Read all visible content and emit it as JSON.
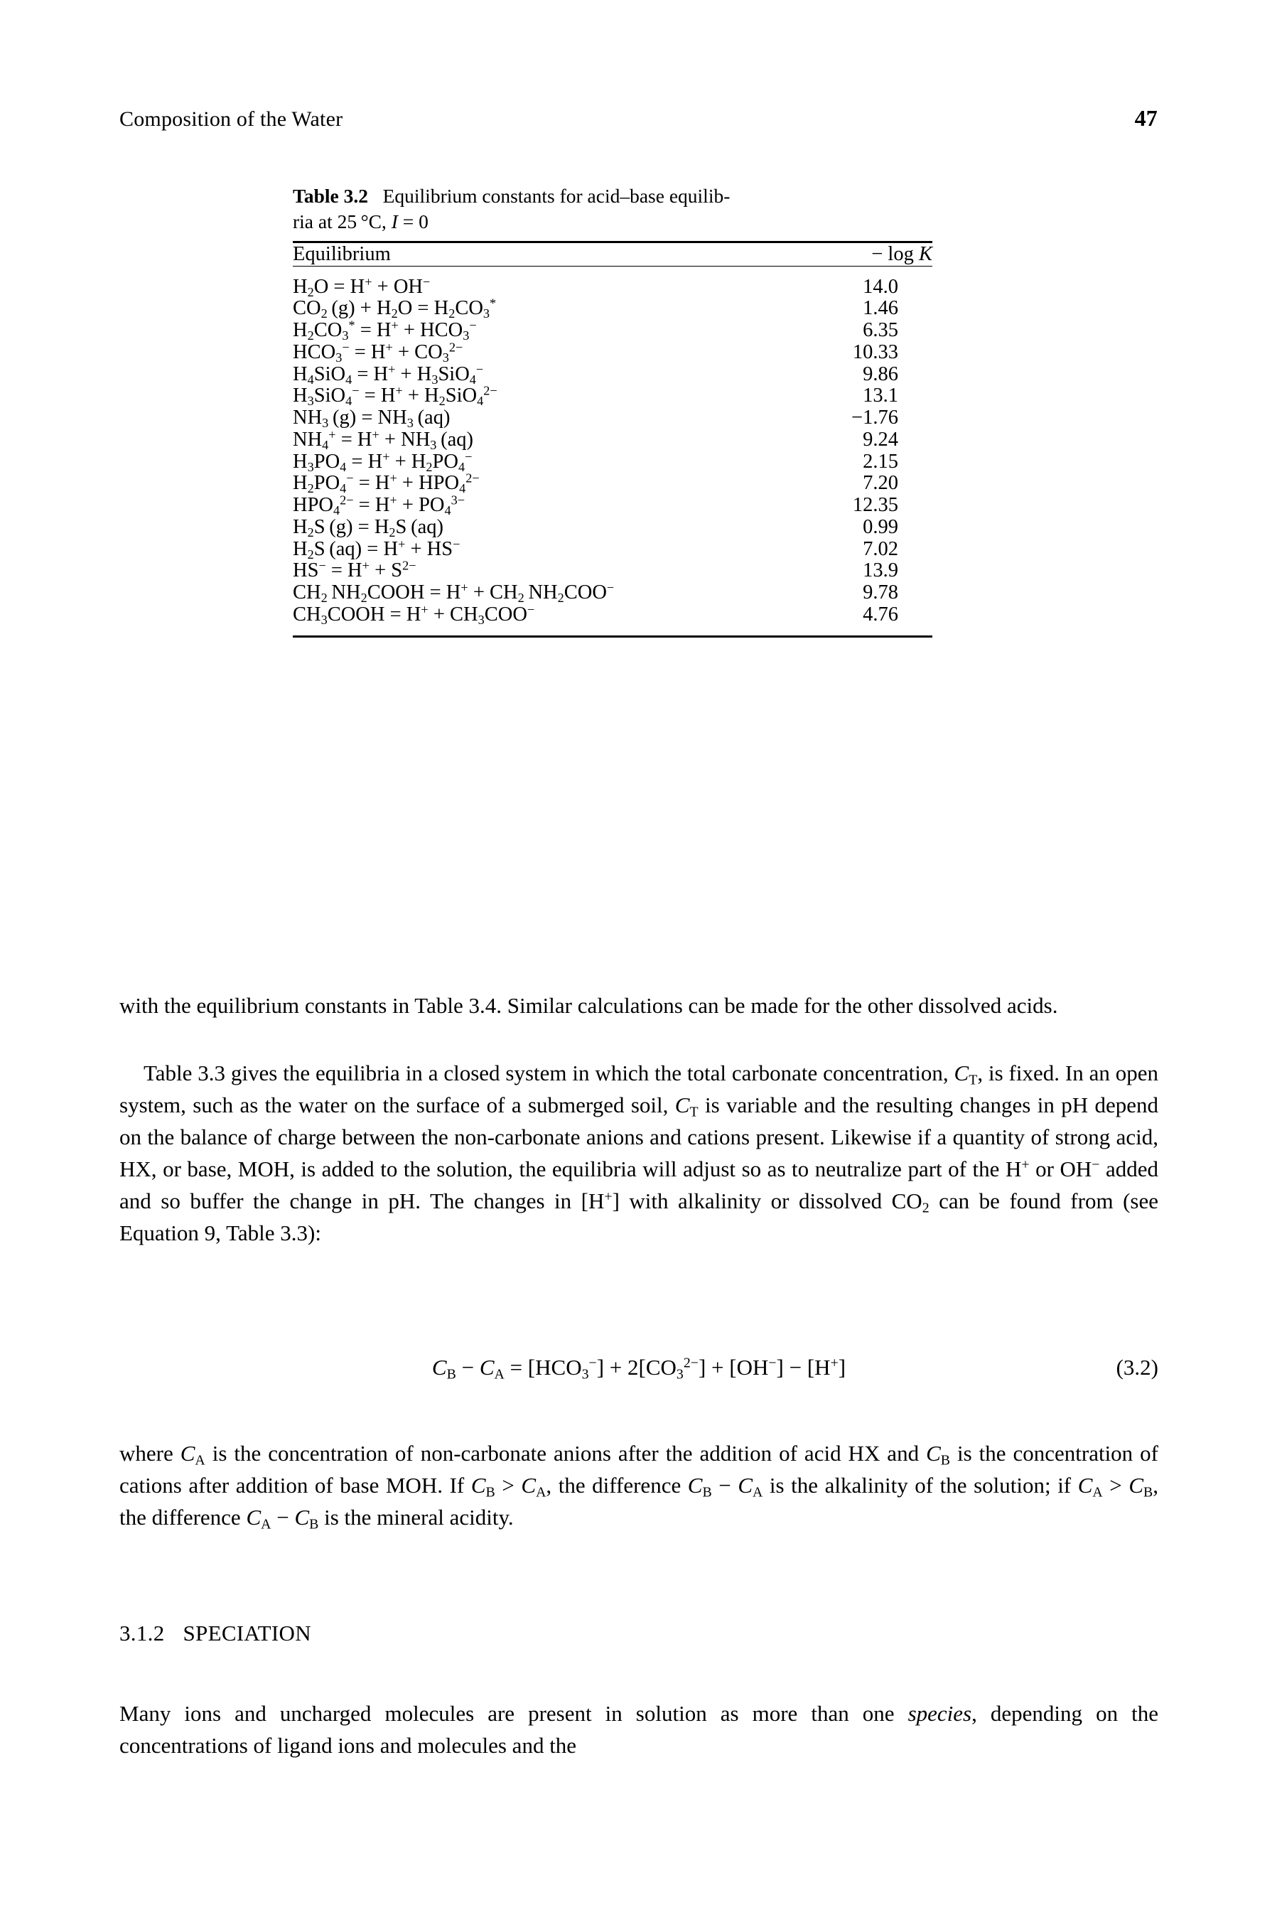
{
  "page": {
    "running_head": "Composition of the Water",
    "folio": "47"
  },
  "table": {
    "label": "Table 3.2",
    "caption_line1": "Equilibrium constants for acid–base equilib-",
    "caption_line2_pre": "ria at 25 °C, ",
    "caption_line2_var": "I",
    "caption_line2_post": " = 0",
    "headers": {
      "equilibrium": "Equilibrium",
      "logk_pre": "− log ",
      "logk_var": "K"
    },
    "rows": [
      {
        "equilibrium": "H2O = H+ + OH−",
        "value": "14.0"
      },
      {
        "equilibrium": "CO2(g) + H2O = H2CO3*",
        "value": "1.46"
      },
      {
        "equilibrium": "H2CO3* = H+ + HCO3−",
        "value": "6.35"
      },
      {
        "equilibrium": "HCO3− = H+ + CO32−",
        "value": "10.33"
      },
      {
        "equilibrium": "H4SiO4 = H+ + H3SiO4−",
        "value": "9.86"
      },
      {
        "equilibrium": "H3SiO4− = H+ + H2SiO42−",
        "value": "13.1"
      },
      {
        "equilibrium": "NH3(g) = NH3(aq)",
        "value": "−1.76"
      },
      {
        "equilibrium": "NH4+ = H+ + NH3(aq)",
        "value": "9.24"
      },
      {
        "equilibrium": "H3PO4 = H+ + H2PO4−",
        "value": "2.15"
      },
      {
        "equilibrium": "H2PO4− = H+ + HPO42−",
        "value": "7.20"
      },
      {
        "equilibrium": "HPO42− = H+ + PO43−",
        "value": "12.35"
      },
      {
        "equilibrium": "H2S(g) = H2S(aq)",
        "value": "0.99"
      },
      {
        "equilibrium": "H2S(aq) = H+ + HS−",
        "value": "7.02"
      },
      {
        "equilibrium": "HS− = H+ + S2−",
        "value": "13.9"
      },
      {
        "equilibrium": "CH2 NH2COOH = H+ + CH2 NH2COO−",
        "value": "9.78"
      },
      {
        "equilibrium": "CH3COOH = H+ + CH3COO−",
        "value": "4.76"
      }
    ]
  },
  "body": {
    "para1": "with the equilibrium constants in Table 3.4. Similar calculations can be made for the other dissolved acids.",
    "para2_a": "Table 3.3 gives the equilibria in a closed system in which the total carbonate concentration, ",
    "para2_b": ", is fixed. In an open system, such as the water on the surface of a submerged soil, ",
    "para2_c": " is variable and the resulting changes in pH depend on the balance of charge between the non-carbonate anions and cations present. Likewise if a quantity of strong acid, HX, or base, MOH, is added to the solution, the equilibria will adjust so as to neutralize part of the H",
    "para2_d": " or OH",
    "para2_e": " added and so buffer the change in pH. The changes in [H",
    "para2_f": "] with alkalinity or dissolved CO",
    "para2_g": " can be found from (see Equation 9, Table 3.3):",
    "para3_a": "where ",
    "para3_b": " is the concentration of non-carbonate anions after the addition of acid HX and ",
    "para3_c": " is the concentration of cations after addition of base MOH. If ",
    "para3_d": ", the difference ",
    "para3_e": " is the alkalinity of the solution; if ",
    "para3_f": ", the difference ",
    "para3_g": " is the mineral acidity.",
    "para4_a": "Many ions and uncharged molecules are present in solution as more than one ",
    "para4_italic": "species",
    "para4_b": ", depending on the concentrations of ligand ions and molecules and the"
  },
  "equation": {
    "number": "(3.2)",
    "text": "CB − CA = [HCO3−] + 2[CO32−] + [OH−] − [H+]"
  },
  "section": {
    "number": "3.1.2",
    "title": "SPECIATION"
  }
}
